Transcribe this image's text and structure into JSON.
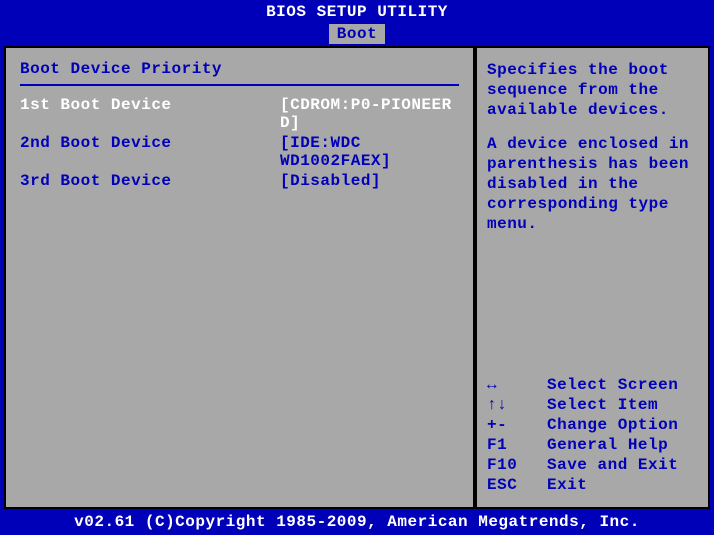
{
  "header": {
    "title": "BIOS SETUP UTILITY",
    "tab": "Boot"
  },
  "left": {
    "section_title": "Boot Device Priority",
    "items": [
      {
        "label": "1st Boot Device",
        "value": "[CDROM:P0-PIONEER D]"
      },
      {
        "label": "2nd Boot Device",
        "value": "[IDE:WDC WD1002FAEX]"
      },
      {
        "label": "3rd Boot Device",
        "value": "[Disabled]"
      }
    ]
  },
  "right": {
    "help1": "Specifies the boot sequence from the available devices.",
    "help2": "A device enclosed in parenthesis has been disabled in the corresponding type menu.",
    "keys": [
      {
        "key": "↔",
        "desc": "Select Screen"
      },
      {
        "key": "↑↓",
        "desc": "Select Item"
      },
      {
        "key": "+-",
        "desc": "Change Option"
      },
      {
        "key": "F1",
        "desc": "General Help"
      },
      {
        "key": "F10",
        "desc": "Save and Exit"
      },
      {
        "key": "ESC",
        "desc": "Exit"
      }
    ]
  },
  "footer": {
    "text": "v02.61 (C)Copyright 1985-2009, American Megatrends, Inc."
  }
}
